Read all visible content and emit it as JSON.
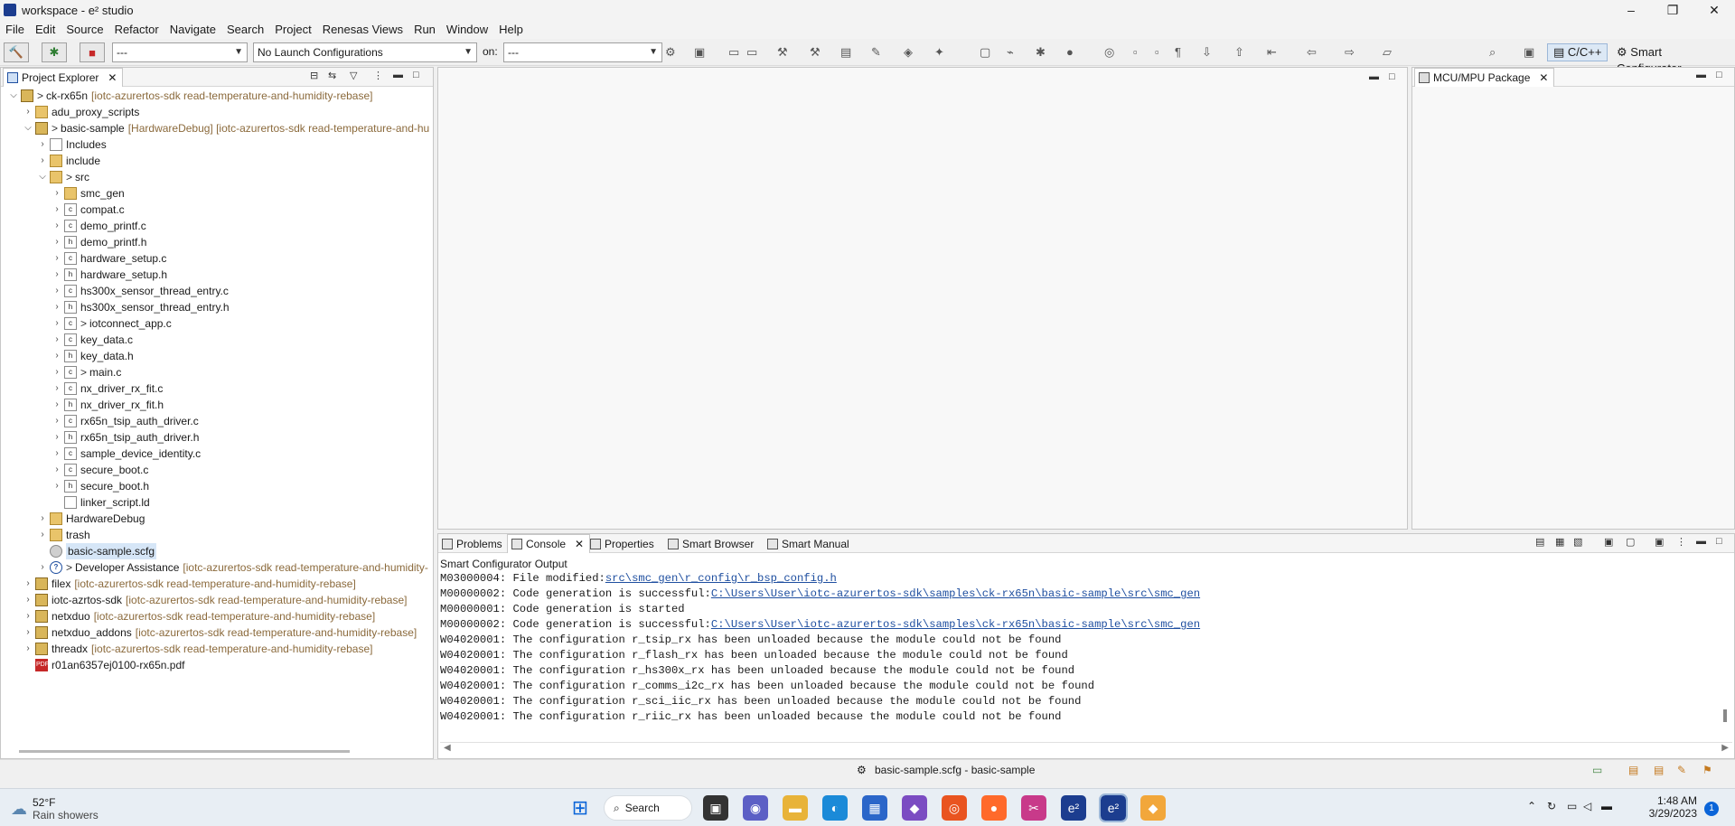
{
  "window": {
    "title": "workspace - e² studio"
  },
  "menu": [
    "File",
    "Edit",
    "Source",
    "Refactor",
    "Navigate",
    "Search",
    "Project",
    "Renesas Views",
    "Run",
    "Window",
    "Help"
  ],
  "toolbar": {
    "launch_mode": "---",
    "launch_config": "No Launch Configurations",
    "on_label": "on:",
    "launch_target": "---",
    "perspective_cpp": "C/C++",
    "perspective_sc": "Smart Configurator"
  },
  "project_explorer": {
    "tab": "Project Explorer",
    "tree": [
      {
        "label": "ck-rx65n",
        "deco": "[iotc-azurertos-sdk read-temperature-and-humidity-rebase]",
        "mark": ">",
        "indent": 0,
        "chev": "down",
        "icon": "proj"
      },
      {
        "label": "adu_proxy_scripts",
        "deco": "",
        "mark": "",
        "indent": 1,
        "chev": "right",
        "icon": "folder"
      },
      {
        "label": "basic-sample",
        "deco": "[HardwareDebug] [iotc-azurertos-sdk read-temperature-and-hu",
        "mark": ">",
        "indent": 1,
        "chev": "down",
        "icon": "proj"
      },
      {
        "label": "Includes",
        "deco": "",
        "mark": "",
        "indent": 2,
        "chev": "right",
        "icon": "file"
      },
      {
        "label": "include",
        "deco": "",
        "mark": "",
        "indent": 2,
        "chev": "right",
        "icon": "folder"
      },
      {
        "label": "src",
        "deco": "",
        "mark": ">",
        "indent": 2,
        "chev": "down",
        "icon": "folder"
      },
      {
        "label": "smc_gen",
        "deco": "",
        "mark": "",
        "indent": 3,
        "chev": "right",
        "icon": "folder"
      },
      {
        "label": "compat.c",
        "deco": "",
        "mark": "",
        "indent": 3,
        "chev": "right",
        "icon": "file"
      },
      {
        "label": "demo_printf.c",
        "deco": "",
        "mark": "",
        "indent": 3,
        "chev": "right",
        "icon": "file"
      },
      {
        "label": "demo_printf.h",
        "deco": "",
        "mark": "",
        "indent": 3,
        "chev": "right",
        "icon": "file"
      },
      {
        "label": "hardware_setup.c",
        "deco": "",
        "mark": "",
        "indent": 3,
        "chev": "right",
        "icon": "file"
      },
      {
        "label": "hardware_setup.h",
        "deco": "",
        "mark": "",
        "indent": 3,
        "chev": "right",
        "icon": "file"
      },
      {
        "label": "hs300x_sensor_thread_entry.c",
        "deco": "",
        "mark": "",
        "indent": 3,
        "chev": "right",
        "icon": "file"
      },
      {
        "label": "hs300x_sensor_thread_entry.h",
        "deco": "",
        "mark": "",
        "indent": 3,
        "chev": "right",
        "icon": "file"
      },
      {
        "label": "iotconnect_app.c",
        "deco": "",
        "mark": ">",
        "indent": 3,
        "chev": "right",
        "icon": "file"
      },
      {
        "label": "key_data.c",
        "deco": "",
        "mark": "",
        "indent": 3,
        "chev": "right",
        "icon": "file"
      },
      {
        "label": "key_data.h",
        "deco": "",
        "mark": "",
        "indent": 3,
        "chev": "right",
        "icon": "file"
      },
      {
        "label": "main.c",
        "deco": "",
        "mark": ">",
        "indent": 3,
        "chev": "right",
        "icon": "file"
      },
      {
        "label": "nx_driver_rx_fit.c",
        "deco": "",
        "mark": "",
        "indent": 3,
        "chev": "right",
        "icon": "file"
      },
      {
        "label": "nx_driver_rx_fit.h",
        "deco": "",
        "mark": "",
        "indent": 3,
        "chev": "right",
        "icon": "file"
      },
      {
        "label": "rx65n_tsip_auth_driver.c",
        "deco": "",
        "mark": "",
        "indent": 3,
        "chev": "right",
        "icon": "file"
      },
      {
        "label": "rx65n_tsip_auth_driver.h",
        "deco": "",
        "mark": "",
        "indent": 3,
        "chev": "right",
        "icon": "file"
      },
      {
        "label": "sample_device_identity.c",
        "deco": "",
        "mark": "",
        "indent": 3,
        "chev": "right",
        "icon": "file"
      },
      {
        "label": "secure_boot.c",
        "deco": "",
        "mark": "",
        "indent": 3,
        "chev": "right",
        "icon": "file"
      },
      {
        "label": "secure_boot.h",
        "deco": "",
        "mark": "",
        "indent": 3,
        "chev": "right",
        "icon": "file"
      },
      {
        "label": "linker_script.ld",
        "deco": "",
        "mark": "",
        "indent": 3,
        "chev": "none",
        "icon": "file"
      },
      {
        "label": "HardwareDebug",
        "deco": "",
        "mark": "",
        "indent": 2,
        "chev": "right",
        "icon": "folder"
      },
      {
        "label": "trash",
        "deco": "",
        "mark": "",
        "indent": 2,
        "chev": "right",
        "icon": "folder"
      },
      {
        "label": "basic-sample.scfg",
        "deco": "",
        "mark": "",
        "indent": 2,
        "chev": "none",
        "icon": "cfg",
        "selected": true
      },
      {
        "label": "Developer Assistance",
        "deco": "[iotc-azurertos-sdk read-temperature-and-humidity-",
        "mark": ">",
        "indent": 2,
        "chev": "right",
        "icon": "help"
      },
      {
        "label": "filex",
        "deco": "[iotc-azurertos-sdk read-temperature-and-humidity-rebase]",
        "mark": "",
        "indent": 1,
        "chev": "right",
        "icon": "proj"
      },
      {
        "label": "iotc-azrtos-sdk",
        "deco": "[iotc-azurertos-sdk read-temperature-and-humidity-rebase]",
        "mark": "",
        "indent": 1,
        "chev": "right",
        "icon": "proj"
      },
      {
        "label": "netxduo",
        "deco": "[iotc-azurertos-sdk read-temperature-and-humidity-rebase]",
        "mark": "",
        "indent": 1,
        "chev": "right",
        "icon": "proj"
      },
      {
        "label": "netxduo_addons",
        "deco": "[iotc-azurertos-sdk read-temperature-and-humidity-rebase]",
        "mark": "",
        "indent": 1,
        "chev": "right",
        "icon": "proj"
      },
      {
        "label": "threadx",
        "deco": "[iotc-azurertos-sdk read-temperature-and-humidity-rebase]",
        "mark": "",
        "indent": 1,
        "chev": "right",
        "icon": "proj"
      },
      {
        "label": "r01an6357ej0100-rx65n.pdf",
        "deco": "",
        "mark": "",
        "indent": 1,
        "chev": "none",
        "icon": "pdf"
      }
    ]
  },
  "mcu_view": {
    "tab": "MCU/MPU Package"
  },
  "bottom_panel": {
    "tabs": [
      "Problems",
      "Console",
      "Properties",
      "Smart Browser",
      "Smart Manual"
    ],
    "active_tab": "Console",
    "console_title": "Smart Configurator Output",
    "lines": [
      {
        "text": "M03000004: File modified:",
        "link": "src\\smc_gen\\r_config\\r_bsp_config.h"
      },
      {
        "text": "M00000002: Code generation is successful:",
        "link": "C:\\Users\\User\\iotc-azurertos-sdk\\samples\\ck-rx65n\\basic-sample\\src\\smc_gen"
      },
      {
        "text": "M00000001: Code generation is started",
        "link": ""
      },
      {
        "text": "M00000002: Code generation is successful:",
        "link": "C:\\Users\\User\\iotc-azurertos-sdk\\samples\\ck-rx65n\\basic-sample\\src\\smc_gen"
      },
      {
        "text": "W04020001: The configuration r_tsip_rx has been unloaded because the module could not be found",
        "link": ""
      },
      {
        "text": "W04020001: The configuration r_flash_rx has been unloaded because the module could not be found",
        "link": ""
      },
      {
        "text": "W04020001: The configuration r_hs300x_rx has been unloaded because the module could not be found",
        "link": ""
      },
      {
        "text": "W04020001: The configuration r_comms_i2c_rx has been unloaded because the module could not be found",
        "link": ""
      },
      {
        "text": "W04020001: The configuration r_sci_iic_rx has been unloaded because the module could not be found",
        "link": ""
      },
      {
        "text": "W04020001: The configuration r_riic_rx has been unloaded because the module could not be found",
        "link": ""
      }
    ]
  },
  "status": {
    "text": "basic-sample.scfg - basic-sample"
  },
  "taskbar": {
    "weather_temp": "52°F",
    "weather_desc": "Rain showers",
    "search": "Search",
    "time": "1:48 AM",
    "date": "3/29/2023",
    "notif_count": "1"
  }
}
